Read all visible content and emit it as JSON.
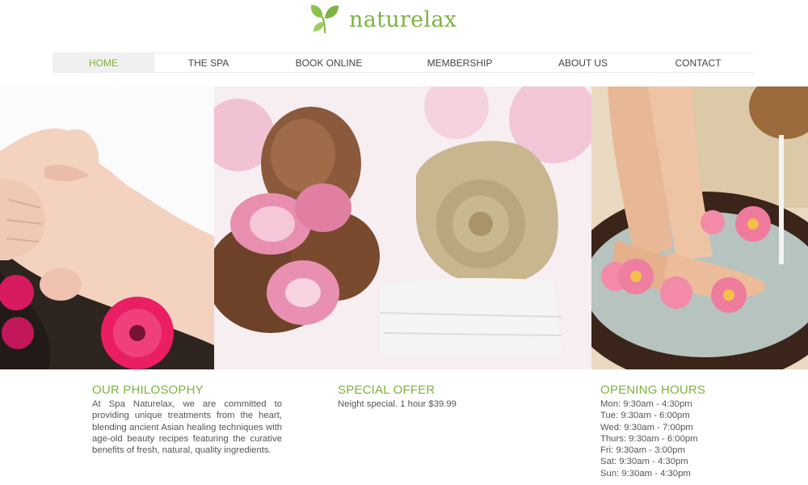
{
  "brand": {
    "name": "naturelax",
    "logo_icon": "leaf-icon",
    "color": "#7cb342"
  },
  "nav": {
    "items": [
      {
        "label": "HOME",
        "active": true
      },
      {
        "label": "THE SPA"
      },
      {
        "label": "BOOK ONLINE"
      },
      {
        "label": "MEMBERSHIP"
      },
      {
        "label": "ABOUT US"
      },
      {
        "label": "CONTACT"
      }
    ]
  },
  "photos": [
    "face-massage-photo",
    "spa-stones-towel-photo",
    "foot-bath-photo"
  ],
  "philosophy": {
    "title": "OUR PHILOSOPHY",
    "text": "At Spa Naturelax, we are committed to providing unique treatments from the heart, blending ancient Asian healing techniques with age-old beauty recipes featuring the curative benefits of fresh, natural, quality ingredients."
  },
  "offer": {
    "title": "SPECIAL OFFER",
    "text": "Neight special. 1 hour $39.99"
  },
  "hours": {
    "title": "OPENING HOURS",
    "lines": [
      "Mon: 9:30am - 4:30pm",
      "Tue: 9:30am - 6:00pm",
      "Wed: 9:30am - 7:00pm",
      "Thurs: 9:30am - 6:00pm",
      "Fri: 9:30am - 3:00pm",
      "Sat: 9:30am - 4:30pm",
      "Sun: 9:30am - 4:30pm"
    ]
  }
}
